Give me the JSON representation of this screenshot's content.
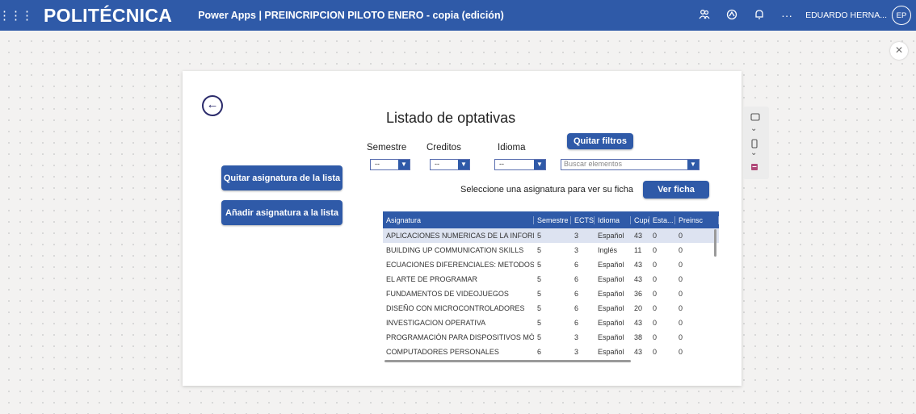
{
  "header": {
    "waffle_glyph": "⋮⋮⋮",
    "logo": "POLITÉCNICA",
    "title": "Power Apps  |  PREINCRIPCION PILOTO ENERO - copia (edición)",
    "icons": [
      "people-icon",
      "flow-icon",
      "bell-icon",
      "more-icon"
    ],
    "more_glyph": "···",
    "user_name": "EDUARDO HERNA...",
    "user_initials": "EP"
  },
  "app": {
    "heading": "Listado de optativas",
    "btn_remove": "Quitar asignatura de la lista",
    "btn_add": "Añadir asignatura a la lista",
    "btn_clear_filters": "Quitar filtros",
    "btn_view": "Ver ficha",
    "hint": "Seleccione una asignatura para ver su ficha",
    "filters": {
      "semestre_label": "Semestre",
      "creditos_label": "Creditos",
      "idioma_label": "Idioma",
      "semestre_value": "--",
      "creditos_value": "--",
      "idioma_value": "--",
      "search_placeholder": "Buscar elementos"
    }
  },
  "table": {
    "columns": [
      "Asignatura",
      "Semestre",
      "ECTS",
      "Idioma",
      "Cupo",
      "Esta...",
      "Preinsc"
    ],
    "rows": [
      [
        "APLICACIONES NUMERICAS DE LA INFORM...",
        "5",
        "3",
        "Español",
        "43",
        "0",
        "0"
      ],
      [
        "BUILDING UP COMMUNICATION SKILLS",
        "5",
        "3",
        "Inglés",
        "11",
        "0",
        "0"
      ],
      [
        "ECUACIONES DIFERENCIALES: METODOS Y ...",
        "5",
        "6",
        "Español",
        "43",
        "0",
        "0"
      ],
      [
        "EL ARTE DE PROGRAMAR",
        "5",
        "6",
        "Español",
        "43",
        "0",
        "0"
      ],
      [
        "FUNDAMENTOS DE VIDEOJUEGOS",
        "5",
        "6",
        "Español",
        "36",
        "0",
        "0"
      ],
      [
        "DISEÑO CON MICROCONTROLADORES",
        "5",
        "6",
        "Español",
        "20",
        "0",
        "0"
      ],
      [
        "INVESTIGACION OPERATIVA",
        "5",
        "6",
        "Español",
        "43",
        "0",
        "0"
      ],
      [
        "PROGRAMACIÓN PARA DISPOSITIVOS MÓ...",
        "5",
        "3",
        "Español",
        "38",
        "0",
        "0"
      ],
      [
        "COMPUTADORES PERSONALES",
        "6",
        "3",
        "Español",
        "43",
        "0",
        "0"
      ]
    ]
  },
  "colors": {
    "brand": "#2f5aa8",
    "selected_row": "#dde3f1"
  }
}
